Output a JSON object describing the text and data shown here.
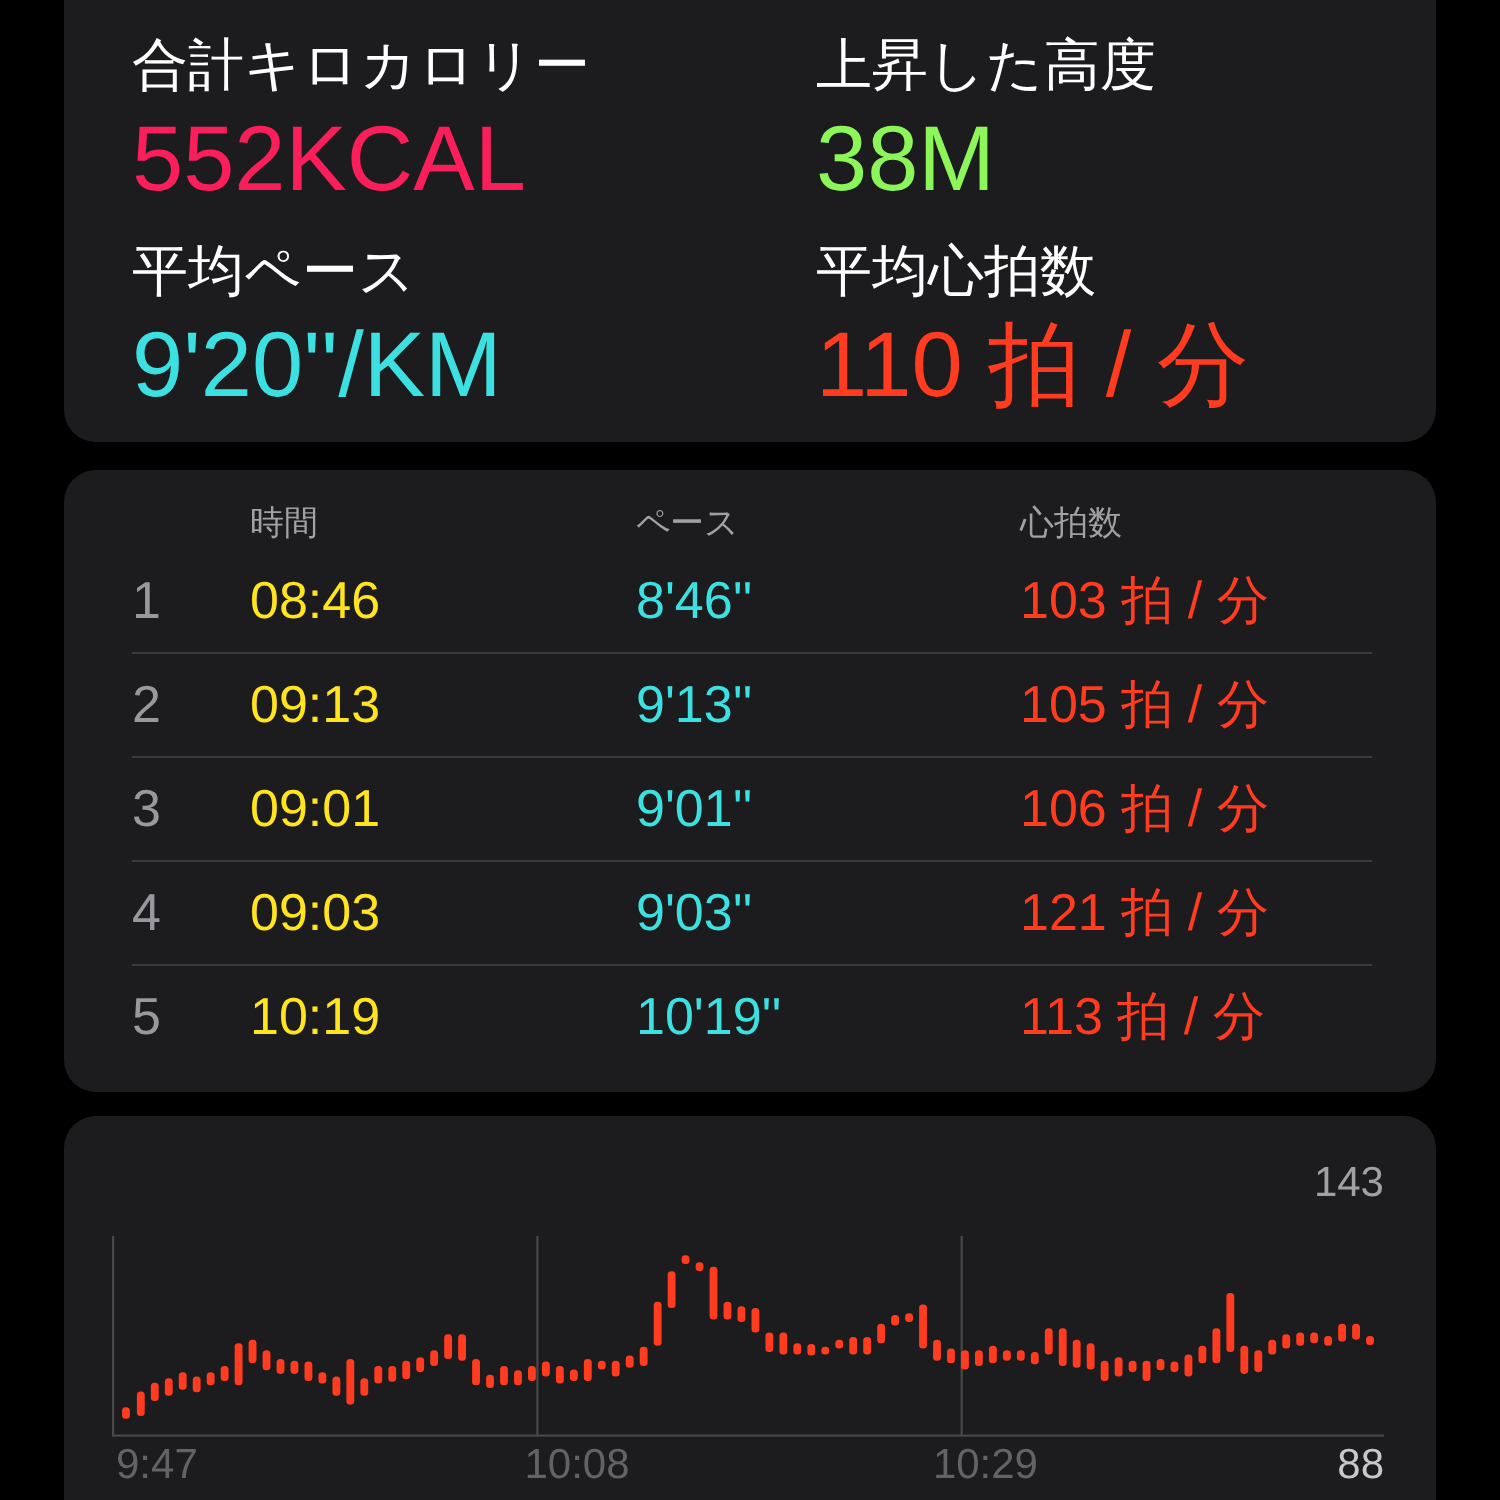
{
  "summary": [
    {
      "label": "合計キロカロリー",
      "value": "552KCAL",
      "color": "#fa1f5a"
    },
    {
      "label": "上昇した高度",
      "value": "38M",
      "color": "#8cf55a"
    },
    {
      "label": "平均ペース",
      "value": "9'20''/KM",
      "color": "#3de0e0"
    },
    {
      "label": "平均心拍数",
      "value": "110 拍 / 分",
      "color": "#ff3b20"
    }
  ],
  "splits": {
    "columns": [
      "時間",
      "ペース",
      "心拍数"
    ],
    "rows": [
      {
        "number": "1",
        "time": "08:46",
        "pace": "8'46''",
        "heart_rate": "103 拍 / 分"
      },
      {
        "number": "2",
        "time": "09:13",
        "pace": "9'13''",
        "heart_rate": "105 拍 / 分"
      },
      {
        "number": "3",
        "time": "09:01",
        "pace": "9'01''",
        "heart_rate": "106 拍 / 分"
      },
      {
        "number": "4",
        "time": "09:03",
        "pace": "9'03''",
        "heart_rate": "121 拍 / 分"
      },
      {
        "number": "5",
        "time": "10:19",
        "pace": "10'19''",
        "heart_rate": "113 拍 / 分"
      }
    ]
  },
  "heart_chart": {
    "max_label": "143",
    "min_label": "88",
    "time_labels": [
      "9:47",
      "10:08",
      "10:29"
    ]
  }
}
